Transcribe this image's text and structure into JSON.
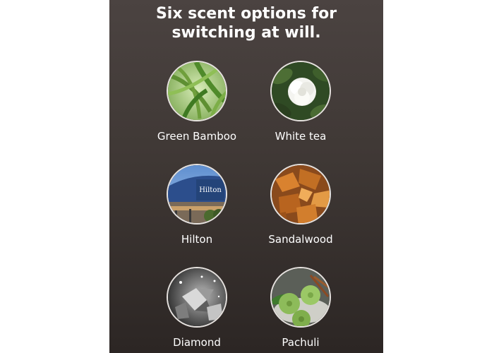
{
  "heading": {
    "line1": "Six scent options for",
    "line2": "switching at will."
  },
  "scents": [
    {
      "label": "Green Bamboo",
      "icon": "bamboo-leaves-image"
    },
    {
      "label": "White tea",
      "icon": "white-camellia-flower-image"
    },
    {
      "label": "Hilton",
      "icon": "hilton-hotel-building-image",
      "sign_text": "Hilton"
    },
    {
      "label": "Sandalwood",
      "icon": "sandalwood-chips-image"
    },
    {
      "label": "Diamond",
      "icon": "diamond-crystals-image"
    },
    {
      "label": "Pachuli",
      "icon": "pachuli-fruit-image"
    }
  ],
  "colors": {
    "panel_top": "#4b4341",
    "panel_bottom": "#2c2624",
    "text": "#ffffff",
    "circle_border": "#e6e2df"
  }
}
